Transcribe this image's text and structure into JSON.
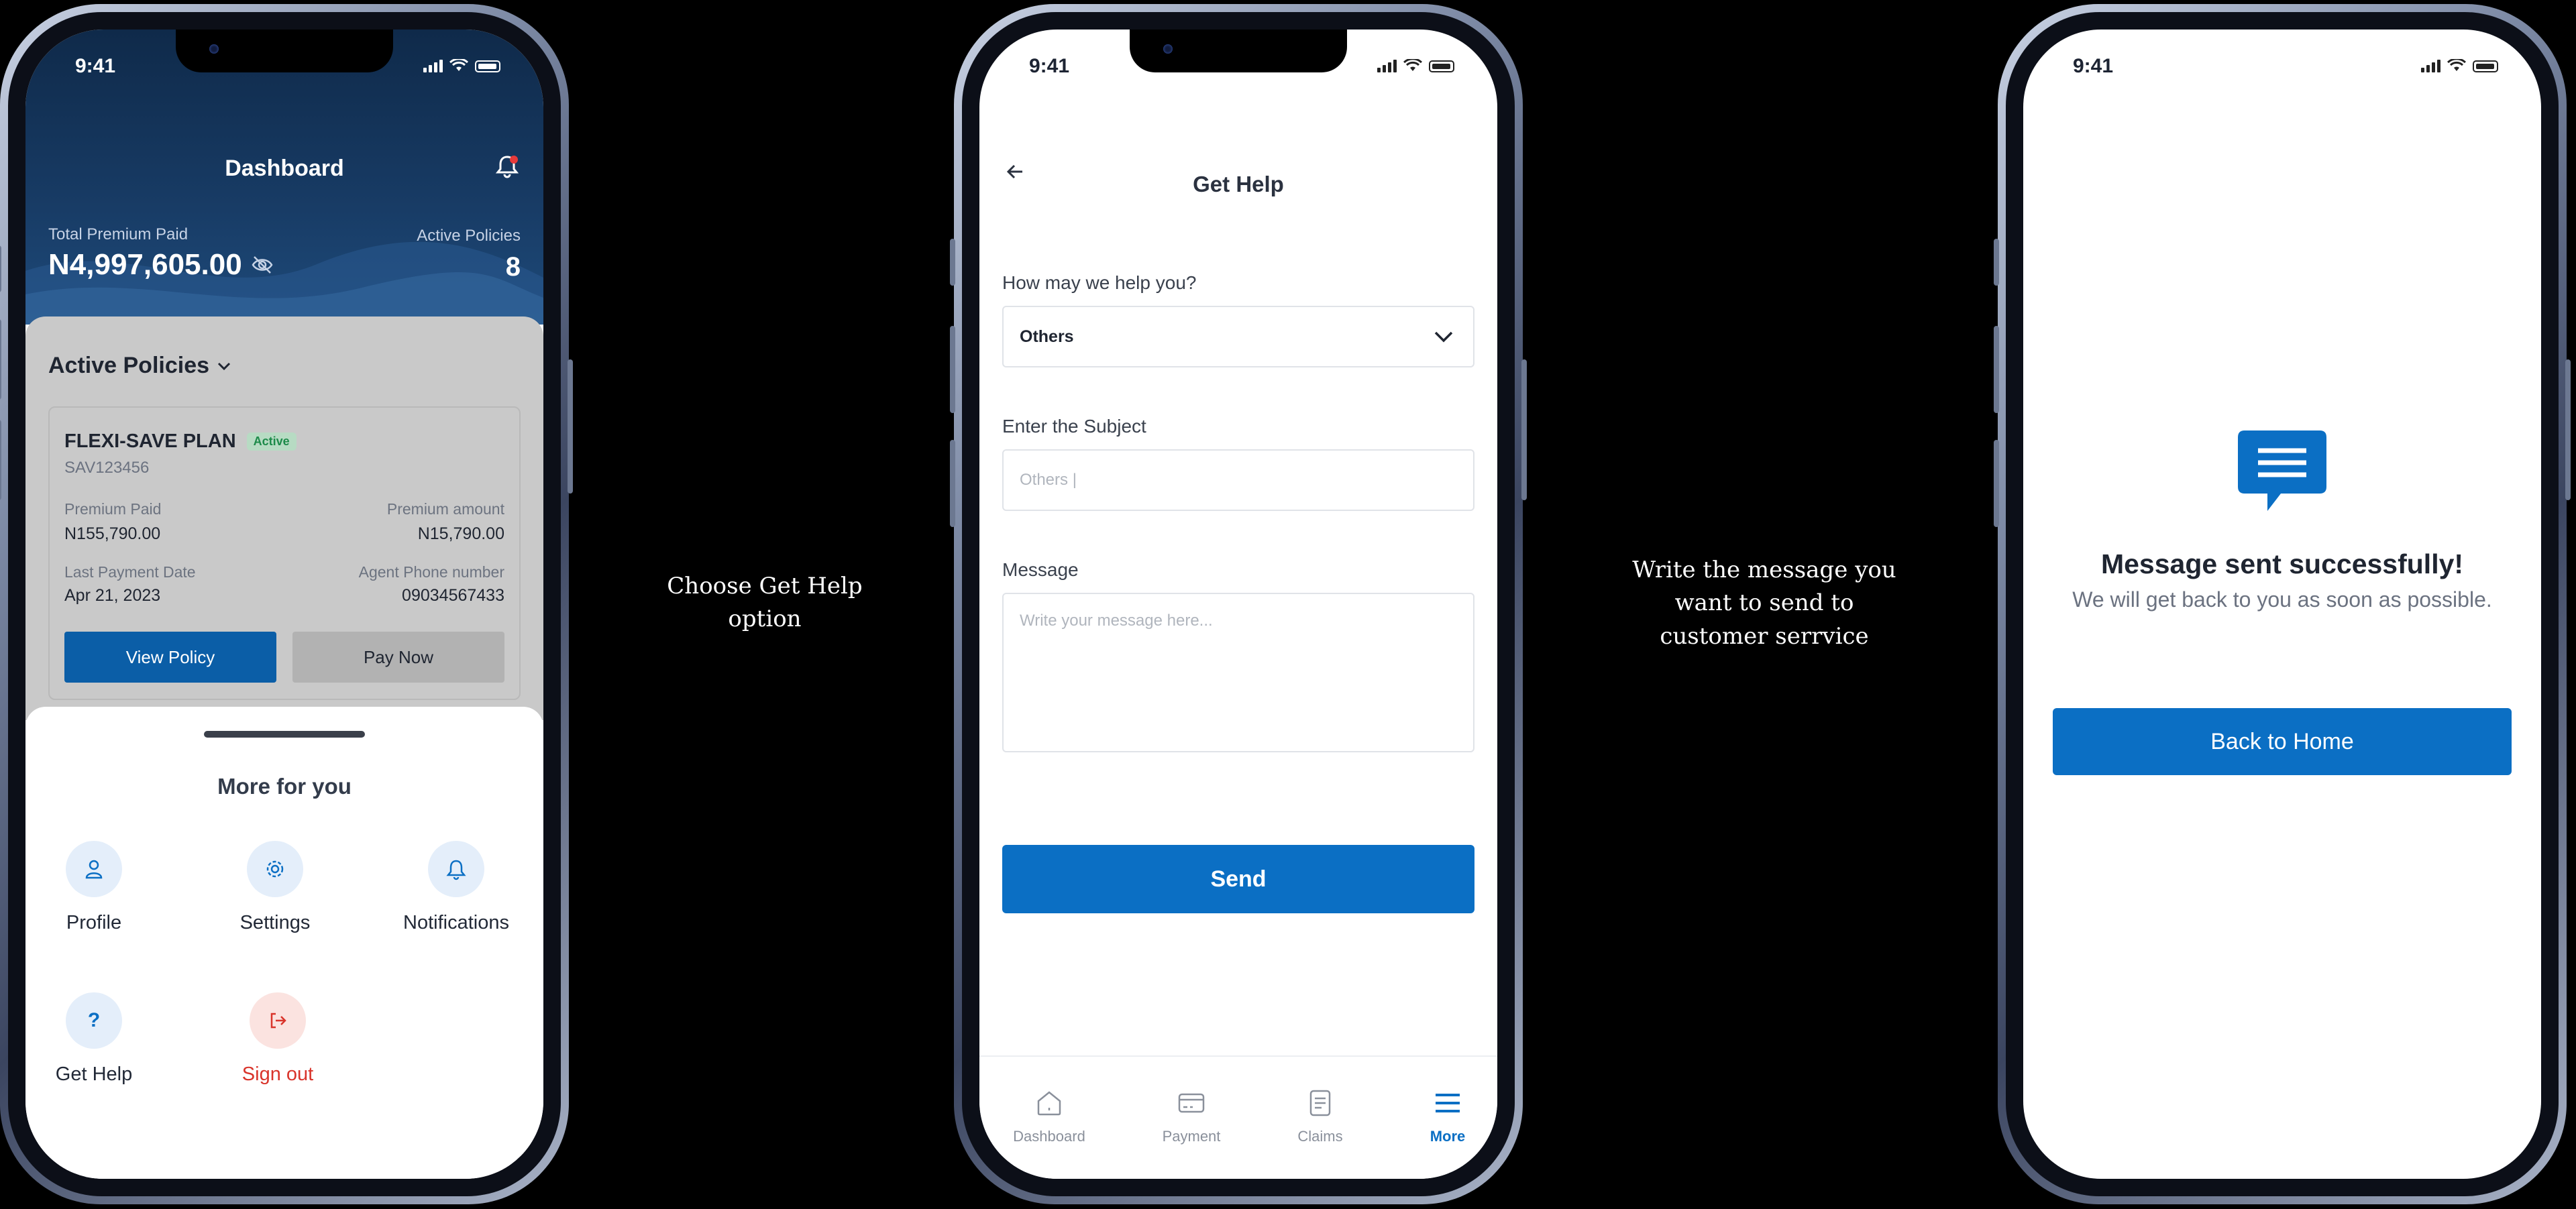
{
  "status": {
    "time": "9:41"
  },
  "dashboard": {
    "title": "Dashboard",
    "total_premium_label": "Total Premium Paid",
    "total_premium_value": "N4,997,605.00",
    "active_policies_label": "Active Policies",
    "active_policies_count": "8",
    "active_policies_heading": "Active Policies",
    "policy": {
      "name": "FLEXI-SAVE PLAN",
      "status": "Active",
      "code": "SAV123456",
      "premium_paid_label": "Premium Paid",
      "premium_paid_value": "N155,790.00",
      "premium_amount_label": "Premium amount",
      "premium_amount_value": "N15,790.00",
      "last_payment_label": "Last Payment Date",
      "last_payment_value": "Apr 21, 2023",
      "agent_phone_label": "Agent Phone number",
      "agent_phone_value": "09034567433",
      "view_button": "View Policy",
      "pay_button": "Pay Now"
    },
    "more_title": "More for you",
    "more_items": [
      {
        "label": "Profile",
        "icon": "user-icon"
      },
      {
        "label": "Settings",
        "icon": "gear-icon"
      },
      {
        "label": "Notifications",
        "icon": "bell-icon"
      },
      {
        "label": "Get Help",
        "icon": "question-icon"
      },
      {
        "label": "Sign out",
        "icon": "sign-out-icon"
      }
    ]
  },
  "captions": {
    "step1": [
      "Choose Get Help",
      "option"
    ],
    "step2": [
      "Write the message you",
      "want to send to",
      "customer serrvice"
    ]
  },
  "get_help": {
    "title": "Get Help",
    "how_label": "How may we help you?",
    "how_value": "Others",
    "subject_label": "Enter the Subject",
    "subject_placeholder": "Others |",
    "message_label": "Message",
    "message_placeholder": "Write your message here...",
    "send_button": "Send",
    "tabs": [
      {
        "label": "Dashboard",
        "icon": "home-icon"
      },
      {
        "label": "Payment",
        "icon": "card-icon"
      },
      {
        "label": "Claims",
        "icon": "document-icon"
      },
      {
        "label": "More",
        "icon": "menu-icon"
      }
    ]
  },
  "success": {
    "title": "Message sent successfully!",
    "subtitle": "We will get back to you as soon as possible.",
    "home_button": "Back to Home"
  },
  "colors": {
    "primary": "#0b6fc4",
    "header_navy": "#0f2a4a",
    "danger": "#d9342b",
    "active_badge": "#1d8b4a"
  }
}
